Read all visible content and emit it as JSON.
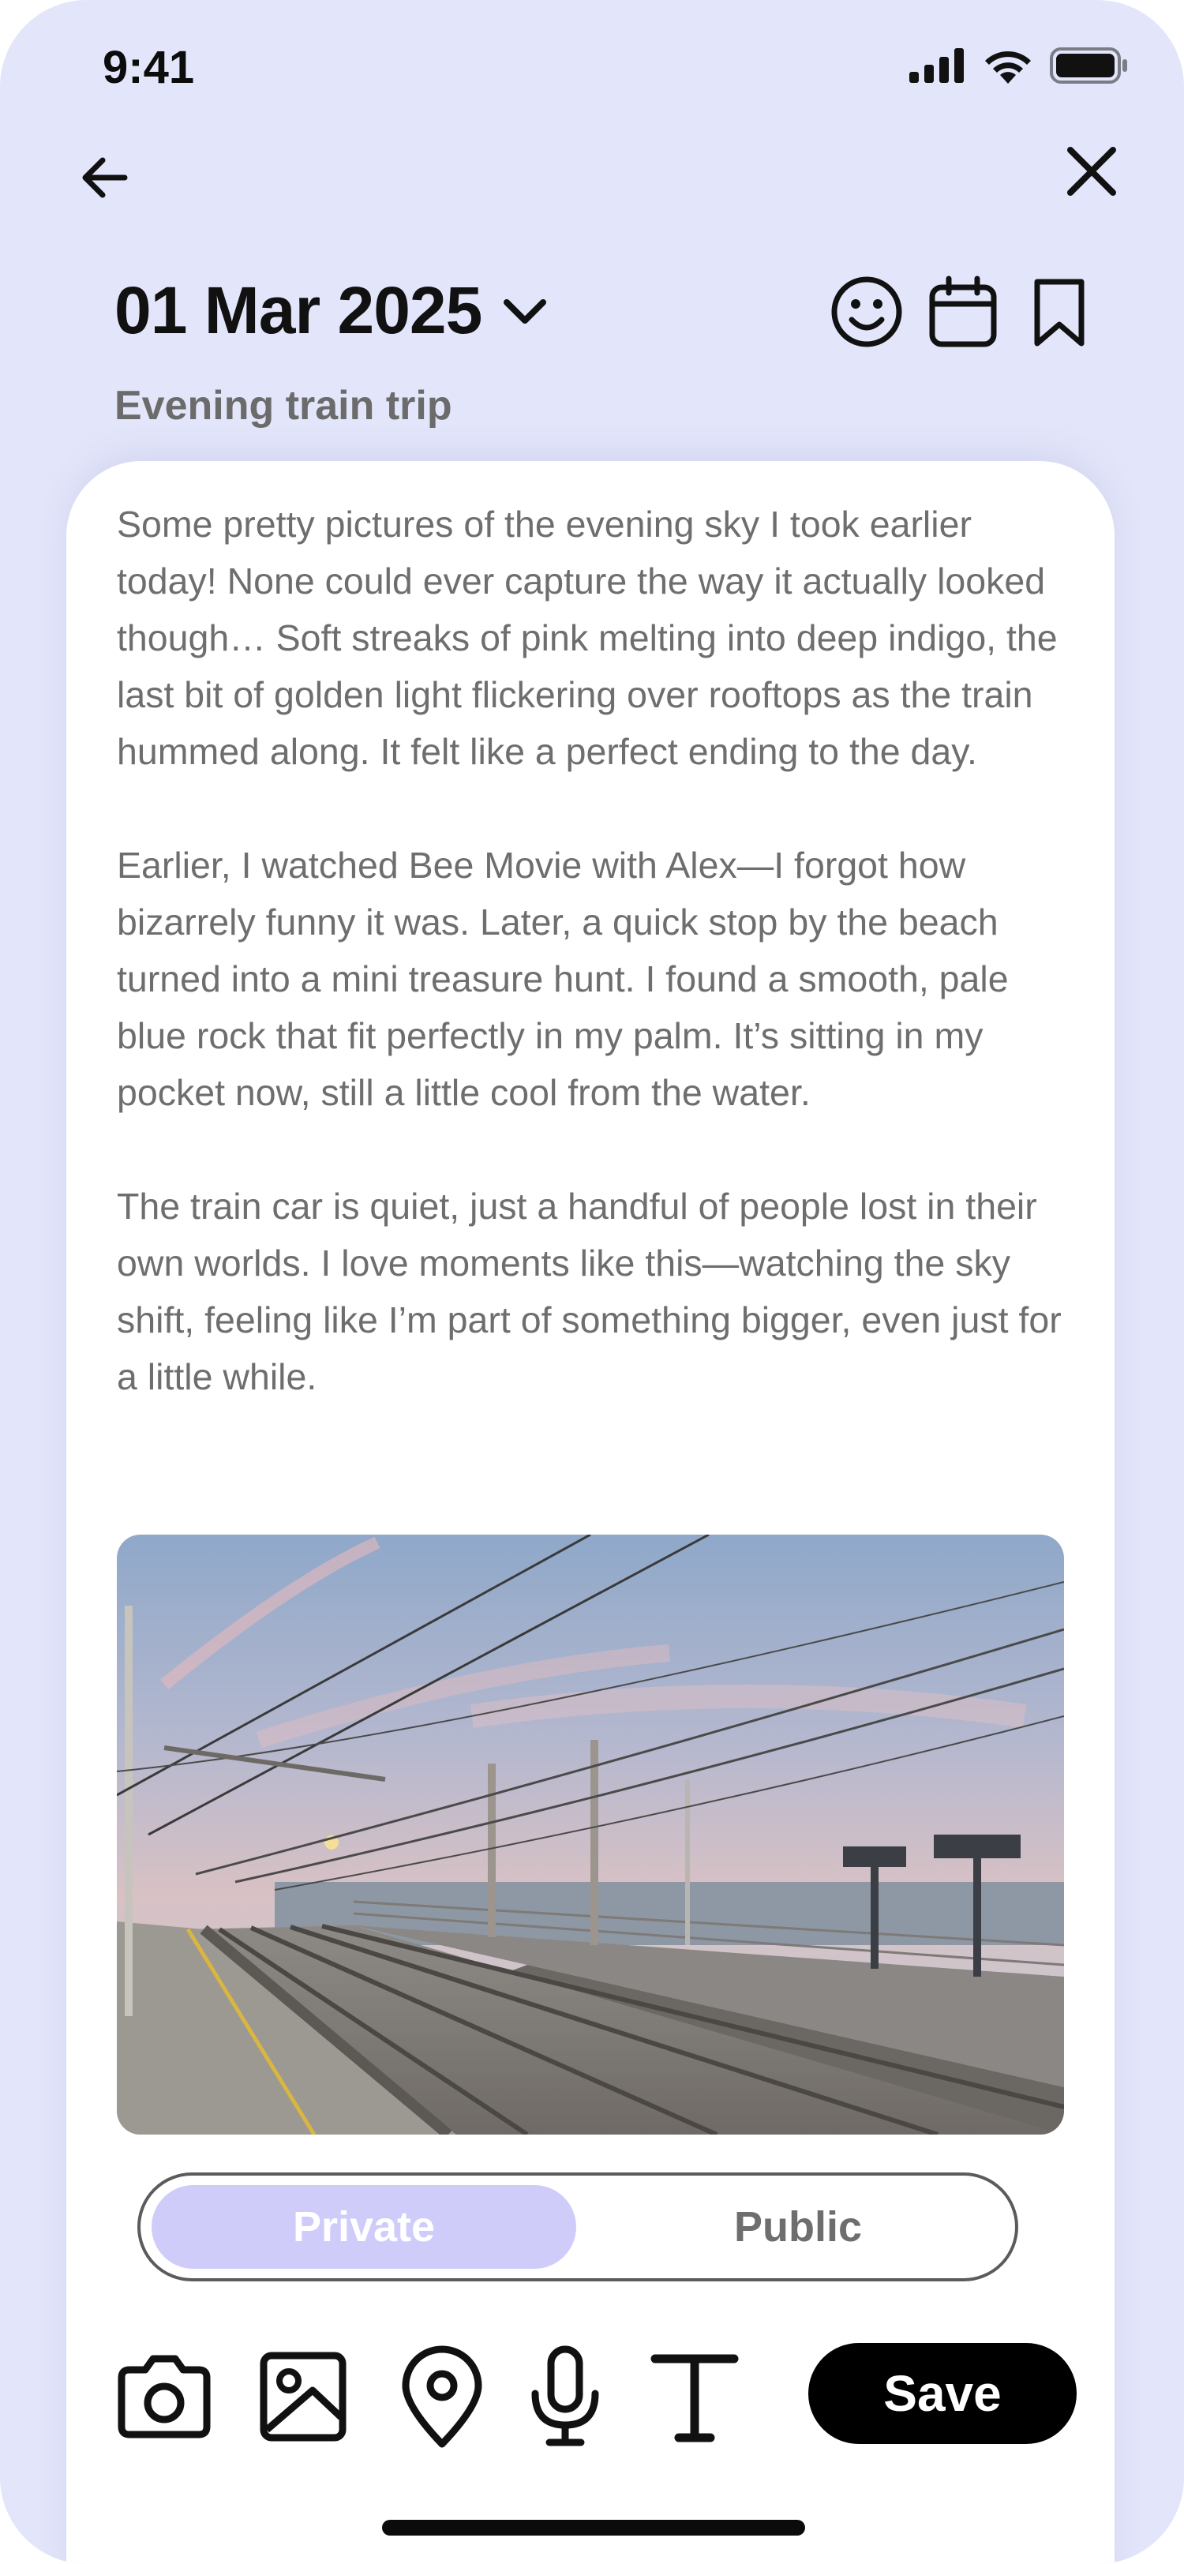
{
  "status_bar": {
    "time": "9:41"
  },
  "nav": {
    "back": "arrow-left-icon",
    "close": "close-icon"
  },
  "entry": {
    "date": "01 Mar 2025",
    "title": "Evening train trip",
    "paragraphs": [
      "Some pretty pictures of the evening sky I took earlier today! None could ever capture the way it actually looked though… Soft streaks of pink melting into deep indigo, the last bit of golden light flickering over rooftops as the train hummed along. It felt like a perfect ending to the day.",
      "Earlier, I watched Bee Movie with Alex—I forgot how bizarrely funny it was. Later, a quick stop by the beach turned into a mini treasure hunt. I found a smooth, pale blue rock that fit perfectly in my palm. It’s sitting in my pocket now, still a little cool from the water.",
      "The train car is quiet, just a handful of people lost in their own worlds. I love moments like this—watching the sky shift, feeling like I’m part of something bigger, even just for a little while."
    ]
  },
  "header_icons": [
    "smiley-icon",
    "calendar-icon",
    "bookmark-icon"
  ],
  "visibility": {
    "private_label": "Private",
    "public_label": "Public",
    "selected": "Private"
  },
  "toolbar": {
    "icons": [
      "camera-icon",
      "image-icon",
      "location-pin-icon",
      "microphone-icon",
      "text-icon"
    ],
    "save_label": "Save"
  },
  "colors": {
    "background": "#e3e6fa",
    "toggle_selected": "#cfccfa",
    "save_button": "#000000"
  }
}
